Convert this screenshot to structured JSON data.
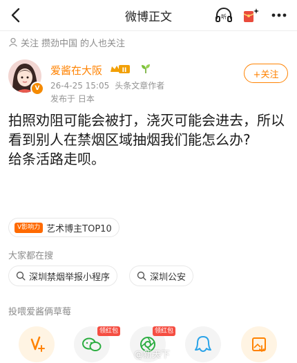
{
  "header": {
    "title": "微博正文",
    "icons": [
      "back-icon",
      "listen-icon",
      "red-packet-icon",
      "more-icon"
    ]
  },
  "follow_note": {
    "part1": "关注",
    "part2": "攒劲中国",
    "part3": "的人也关注"
  },
  "author": {
    "name": "爱酱在大阪",
    "level_badge": "II",
    "verified_badge": "V",
    "time": "26-4-25 15:05",
    "role": "头条文章作者",
    "location": "发布于 日本",
    "follow_label": "+关注"
  },
  "post": {
    "paragraph1": "拍照劝阻可能会被打，浇灭可能会进去，所以看到别人在禁烟区域抽烟我们能怎么办?",
    "paragraph2": "给条活路走呗。"
  },
  "tag": {
    "badge": "V影响力",
    "label": "艺术博主TOP10"
  },
  "search_section": {
    "title": "大家都在搜",
    "items": [
      "深圳禁烟举报小程序",
      "深圳公安"
    ]
  },
  "feed_section": {
    "title": "投喂爱酱俩草莓"
  },
  "actions": {
    "red_packet_label": "领红包",
    "items": [
      "tip-icon",
      "wechat-icon",
      "moments-icon",
      "qq-icon",
      "save-image-icon"
    ]
  },
  "watermark": {
    "text": "@新天下"
  },
  "colors": {
    "brand": "#ff8200",
    "red": "#f54e42",
    "gray_text": "#8c8c8c"
  }
}
